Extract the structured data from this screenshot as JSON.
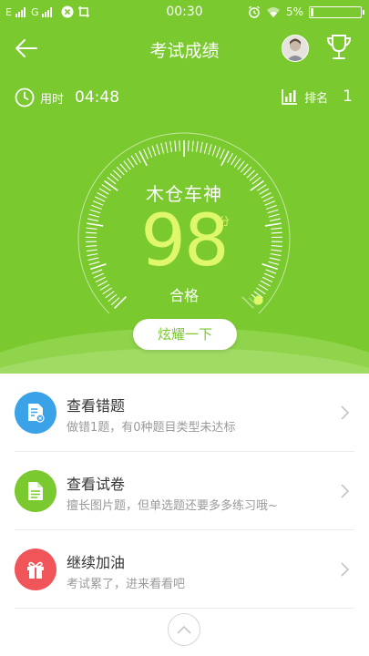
{
  "status_bar": {
    "carrier1": "E",
    "carrier2": "G",
    "time": "00:30",
    "battery_percent": "5%",
    "battery_level": 0.05
  },
  "nav": {
    "title": "考试成绩",
    "back_icon": "back-arrow-icon",
    "trophy_icon": "trophy-icon"
  },
  "info": {
    "time_label": "用时",
    "time_value": "04:48",
    "rank_label": "排名",
    "rank_value": "1"
  },
  "result": {
    "title": "木仓车神",
    "score": "98",
    "unit": "分",
    "grade": "合格",
    "score_fraction": 0.98
  },
  "share_button": "炫耀一下",
  "list": [
    {
      "title": "查看错题",
      "subtitle": "做错1题，有0种题目类型未达标",
      "color": "#3aa3e8",
      "icon": "error-doc-icon"
    },
    {
      "title": "查看试卷",
      "subtitle": "擅长图片题，但单选题还要多多练习哦~",
      "color": "#7ac92e",
      "icon": "paper-doc-icon"
    },
    {
      "title": "继续加油",
      "subtitle": "考试累了，进来看看吧",
      "color": "#f0555a",
      "icon": "gift-icon"
    }
  ],
  "colors": {
    "primary": "#7ac92e",
    "score": "#dff76a"
  }
}
